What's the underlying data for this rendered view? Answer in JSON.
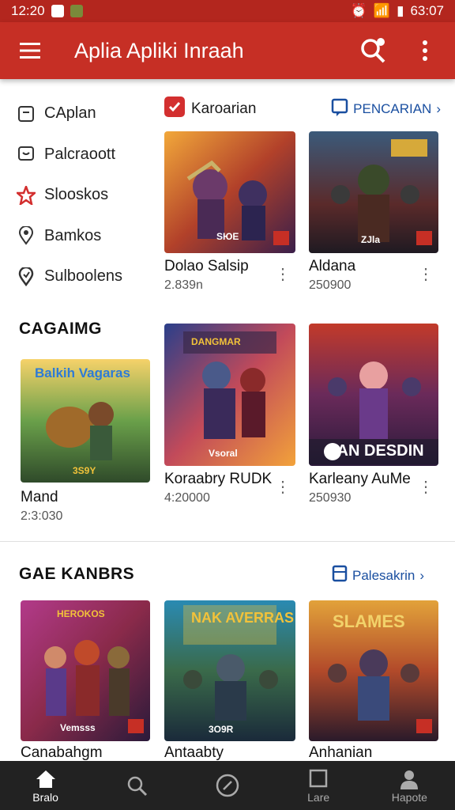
{
  "status": {
    "time": "12:20",
    "right_time": "63:07"
  },
  "appbar": {
    "title": "Aplia Apliki Inraah"
  },
  "sidebar": {
    "items": [
      {
        "label": "CAplan",
        "icon": "bookmark-icon"
      },
      {
        "label": "Palcraoott",
        "icon": "chat-icon"
      },
      {
        "label": "Slooskos",
        "icon": "star-icon"
      },
      {
        "label": "Bamkos",
        "icon": "location-pin-icon"
      },
      {
        "label": "Sulboolens",
        "icon": "pin-outline-icon"
      }
    ]
  },
  "chips": {
    "categories_label": "Karoarian",
    "search_link": "PENCARIAN"
  },
  "row1": [
    {
      "title": "Dolao Salsip",
      "meta": "2.839n",
      "badge": "SЮE"
    },
    {
      "title": "Aldana",
      "meta": "250900",
      "badge": "ZJla"
    }
  ],
  "section_gaming": {
    "title": "CAGAIMG"
  },
  "gaming_cards": [
    {
      "title": "Mand",
      "meta": "2:3:030",
      "art": "Balkih Vagaras",
      "badge": "3S9Y"
    },
    {
      "title": "Koraabry RUDK",
      "meta": "4:20000",
      "art": "DANGMAR",
      "badge": "Vsoral"
    },
    {
      "title": "Karleany AuMe",
      "meta": "250930",
      "art": "GAN DESDIN",
      "badge": ""
    }
  ],
  "section_games": {
    "title": "GAE KANBRS",
    "link": "Palesakrin"
  },
  "games_cards": [
    {
      "title": "Canabahgm",
      "art": "HEROKOS",
      "badge": "Vemsss"
    },
    {
      "title": "Antaabty",
      "art": "NAK AVERRAS",
      "badge": "3O9R"
    },
    {
      "title": "Anhanian",
      "art": "SLAMES",
      "badge": ""
    }
  ],
  "bottomnav": {
    "items": [
      {
        "label": "Bralo",
        "icon": "home-icon",
        "active": true
      },
      {
        "label": "",
        "icon": "search-icon",
        "active": false
      },
      {
        "label": "",
        "icon": "compass-icon",
        "active": false
      },
      {
        "label": "Lare",
        "icon": "square-icon",
        "active": false
      },
      {
        "label": "Hapote",
        "icon": "profile-icon",
        "active": false
      }
    ]
  },
  "colors": {
    "appbar": "#c62f25",
    "statusbar": "#b3261e",
    "link": "#1a4fa0",
    "bottomnav": "#222222"
  }
}
